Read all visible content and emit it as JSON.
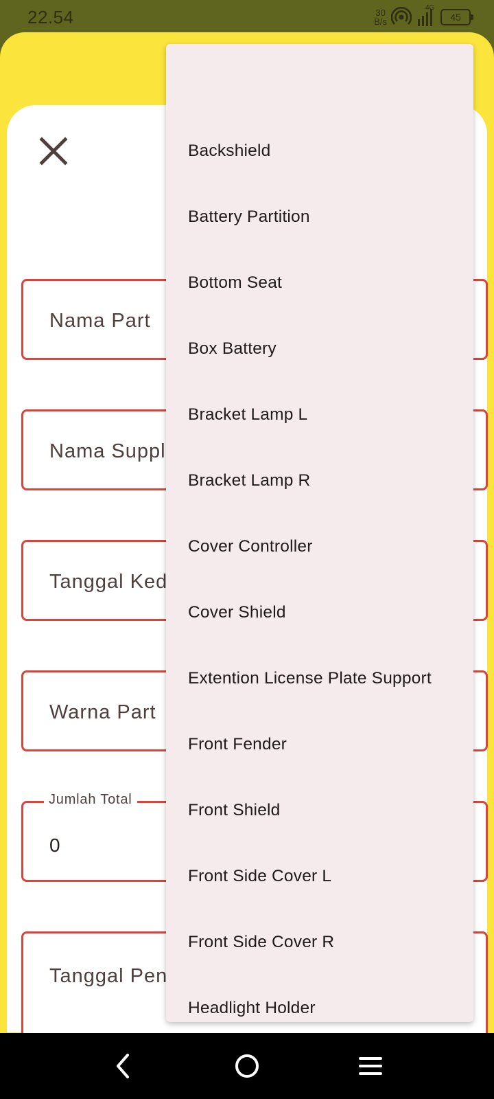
{
  "status_bar": {
    "time": "22.54",
    "net_speed_value": "30",
    "net_speed_unit": "B/s",
    "network_type": "4G",
    "battery": "45"
  },
  "form": {
    "fields": [
      {
        "label": "Nama Part"
      },
      {
        "label": "Nama Suppl"
      },
      {
        "label": "Tanggal Ked"
      },
      {
        "label": "Warna Part"
      },
      {
        "label": "Jumlah Total",
        "value": "0"
      },
      {
        "label": "Tanggal Pen"
      }
    ]
  },
  "dropdown": {
    "options": [
      "Backshield",
      "Battery Partition",
      "Bottom Seat",
      "Box Battery",
      "Bracket Lamp L",
      "Bracket Lamp R",
      "Cover Controller",
      "Cover Shield",
      "Extention License Plate Support",
      "Front Fender",
      "Front Shield",
      "Front Side Cover L",
      "Front Side Cover R",
      "Headlight Holder"
    ]
  },
  "colors": {
    "status_bar": "#5f641e",
    "sheet": "#fbe43b",
    "field_border": "#d9443b",
    "menu_bg": "#f5ebed"
  },
  "icons": {
    "close": "close-icon",
    "back": "back-icon",
    "home": "home-icon",
    "recents": "menu-icon"
  }
}
